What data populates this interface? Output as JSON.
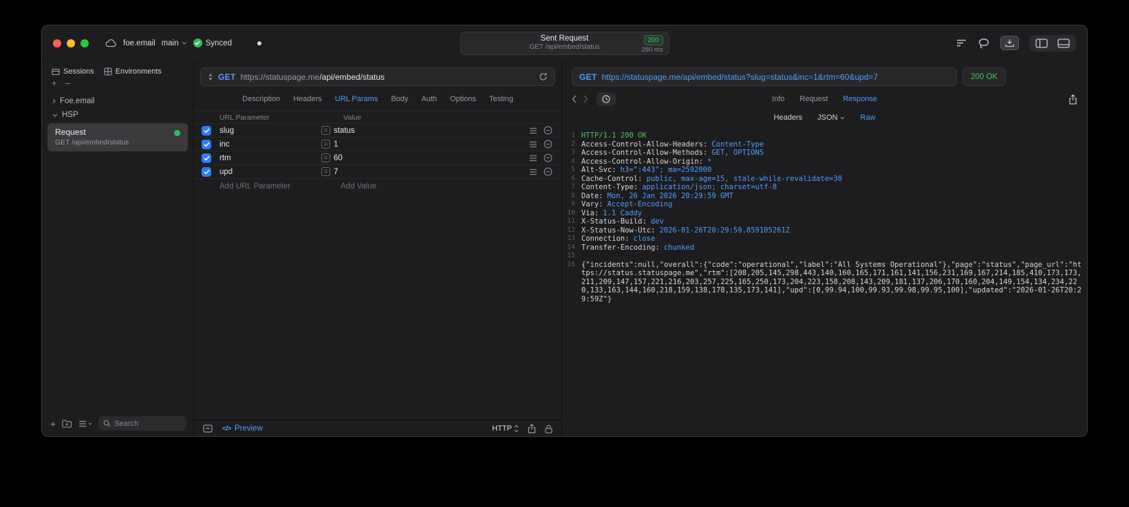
{
  "titlebar": {
    "project_name": "foe.email",
    "branch": "main",
    "sync_label": "Synced",
    "request_summary": {
      "title": "Sent Request",
      "status_code": "200",
      "method_path": "GET /api/embed/status",
      "duration": "280 ms"
    }
  },
  "sidebar": {
    "tabs": [
      {
        "label": "Sessions"
      },
      {
        "label": "Environments"
      }
    ],
    "tree": [
      {
        "label": "Foe.email"
      },
      {
        "label": "HSP"
      }
    ],
    "request_item": {
      "title": "Request",
      "subtitle": "GET /api/embed/status"
    },
    "search_placeholder": "Search"
  },
  "request_panel": {
    "method": "GET",
    "url_base": "https://statuspage.me",
    "url_path": "/api/embed/status",
    "tabs": [
      {
        "label": "Description"
      },
      {
        "label": "Headers"
      },
      {
        "label": "URL Params"
      },
      {
        "label": "Body"
      },
      {
        "label": "Auth"
      },
      {
        "label": "Options"
      },
      {
        "label": "Testing"
      }
    ],
    "params": {
      "col_name": "URL Parameter",
      "col_value": "Value",
      "rows": [
        {
          "name": "slug",
          "value": "status"
        },
        {
          "name": "inc",
          "value": "1"
        },
        {
          "name": "rtm",
          "value": "60"
        },
        {
          "name": "upd",
          "value": "7"
        }
      ],
      "add_name": "Add URL Parameter",
      "add_value": "Add Value"
    },
    "footer": {
      "code_glyph": "</>",
      "preview_label": "Preview",
      "protocol": "HTTP"
    }
  },
  "response_panel": {
    "method": "GET",
    "url": "https://statuspage.me/api/embed/status?slug=status&inc=1&rtm=60&upd=7",
    "status": "200 OK",
    "tabs": [
      {
        "label": "Info"
      },
      {
        "label": "Request"
      },
      {
        "label": "Response"
      }
    ],
    "view_tabs": [
      {
        "label": "Headers"
      },
      {
        "label": "JSON"
      },
      {
        "label": "Raw"
      }
    ],
    "raw_lines": [
      {
        "ln": "1",
        "text": "HTTP/1.1 200 OK"
      },
      {
        "ln": "2",
        "name": "Access-Control-Allow-Headers:",
        "value": "Content-Type"
      },
      {
        "ln": "3",
        "name": "Access-Control-Allow-Methods:",
        "value": "GET, OPTIONS"
      },
      {
        "ln": "4",
        "name": "Access-Control-Allow-Origin:",
        "value": "*"
      },
      {
        "ln": "5",
        "name": "Alt-Svc:",
        "value": "h3=\":443\"; ma=2592000"
      },
      {
        "ln": "6",
        "name": "Cache-Control:",
        "value": "public, max-age=15, stale-while-revalidate=30"
      },
      {
        "ln": "7",
        "name": "Content-Type:",
        "value": "application/json; charset=utf-8"
      },
      {
        "ln": "8",
        "name": "Date:",
        "value": "Mon, 26 Jan 2026 20:29:59 GMT"
      },
      {
        "ln": "9",
        "name": "Vary:",
        "value": "Accept-Encoding"
      },
      {
        "ln": "10",
        "name": "Via:",
        "value": "1.1 Caddy"
      },
      {
        "ln": "11",
        "name": "X-Status-Build:",
        "value": "dev"
      },
      {
        "ln": "12",
        "name": "X-Status-Now-Utc:",
        "value": "2026-01-26T20:29:59.859105261Z"
      },
      {
        "ln": "13",
        "name": "Connection:",
        "value": "close"
      },
      {
        "ln": "14",
        "name": "Transfer-Encoding:",
        "value": "chunked"
      },
      {
        "ln": "15",
        "text": ""
      },
      {
        "ln": "16",
        "text": "{\"incidents\":null,\"overall\":{\"code\":\"operational\",\"label\":\"All Systems Operational\"},\"page\":\"status\",\"page_url\":\"https://status.statuspage.me\",\"rtm\":[208,205,145,298,443,140,160,165,171,161,141,156,231,169,167,214,185,410,173,173,211,209,147,157,221,216,203,257,225,165,250,173,204,223,158,208,143,209,181,137,206,170,160,204,149,154,134,234,220,133,163,144,160,218,159,138,178,135,173,141],\"upd\":[0,99.94,100,99.93,99.98,99.95,100],\"updated\":\"2026-01-26T20:29:59Z\"}"
      }
    ]
  },
  "colors": {
    "accent_blue": "#4D9FFF",
    "success_green": "#30D158",
    "status_line_green": "#4CC05F",
    "checkbox_blue": "#2D7CF7"
  }
}
